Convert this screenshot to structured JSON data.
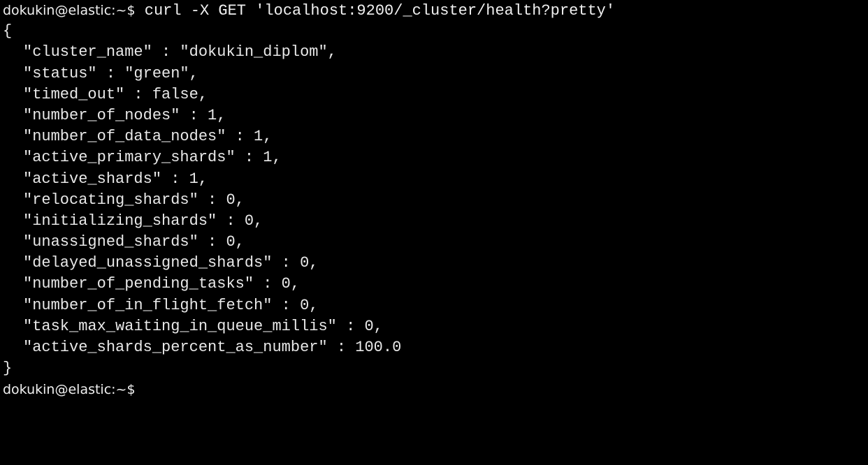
{
  "terminal": {
    "prompt": "dokukin@elastic:~$",
    "command": "curl -X GET 'localhost:9200/_cluster/health?pretty'",
    "open_brace": "{",
    "close_brace": "}",
    "output_lines": [
      "\"cluster_name\" : \"dokukin_diplom\",",
      "\"status\" : \"green\",",
      "\"timed_out\" : false,",
      "\"number_of_nodes\" : 1,",
      "\"number_of_data_nodes\" : 1,",
      "\"active_primary_shards\" : 1,",
      "\"active_shards\" : 1,",
      "\"relocating_shards\" : 0,",
      "\"initializing_shards\" : 0,",
      "\"unassigned_shards\" : 0,",
      "\"delayed_unassigned_shards\" : 0,",
      "\"number_of_pending_tasks\" : 0,",
      "\"number_of_in_flight_fetch\" : 0,",
      "\"task_max_waiting_in_queue_millis\" : 0,",
      "\"active_shards_percent_as_number\" : 100.0"
    ],
    "final_prompt": "dokukin@elastic:~$"
  },
  "colors": {
    "background": "#000000",
    "text": "#e8e8e8"
  }
}
